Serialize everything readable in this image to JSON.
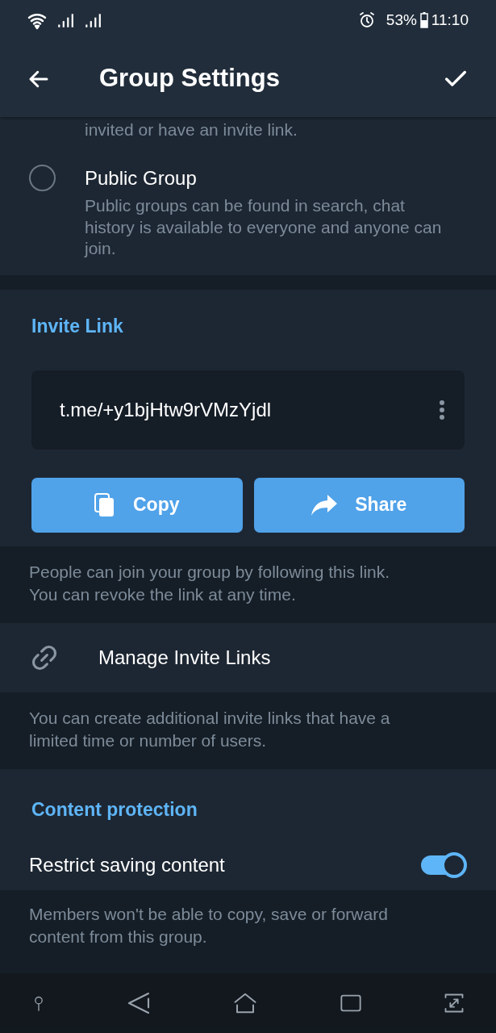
{
  "status_bar": {
    "battery": "53%",
    "time": "11:10"
  },
  "header": {
    "title": "Group Settings"
  },
  "group_type": {
    "private_description_tail": "invited or have an invite link.",
    "options": [
      {
        "label": "Public Group",
        "description": "Public groups can be found in search, chat history is available to everyone and anyone can join.",
        "selected": false
      }
    ]
  },
  "invite_link": {
    "heading": "Invite Link",
    "link": "t.me/+y1bjHtw9rVMzYjdl",
    "buttons": [
      {
        "kind": "copy",
        "label": "Copy"
      },
      {
        "kind": "share",
        "label": "Share"
      }
    ],
    "footer": "People can join your group by following this link. You can revoke the link at any time."
  },
  "manage_links": {
    "label": "Manage Invite Links",
    "footer": "You can create additional invite links that have a limited time or number of users."
  },
  "content_protection": {
    "heading": "Content protection",
    "label": "Restrict saving content",
    "on": true,
    "footer": "Members won't be able to copy, save or forward content from this group."
  }
}
